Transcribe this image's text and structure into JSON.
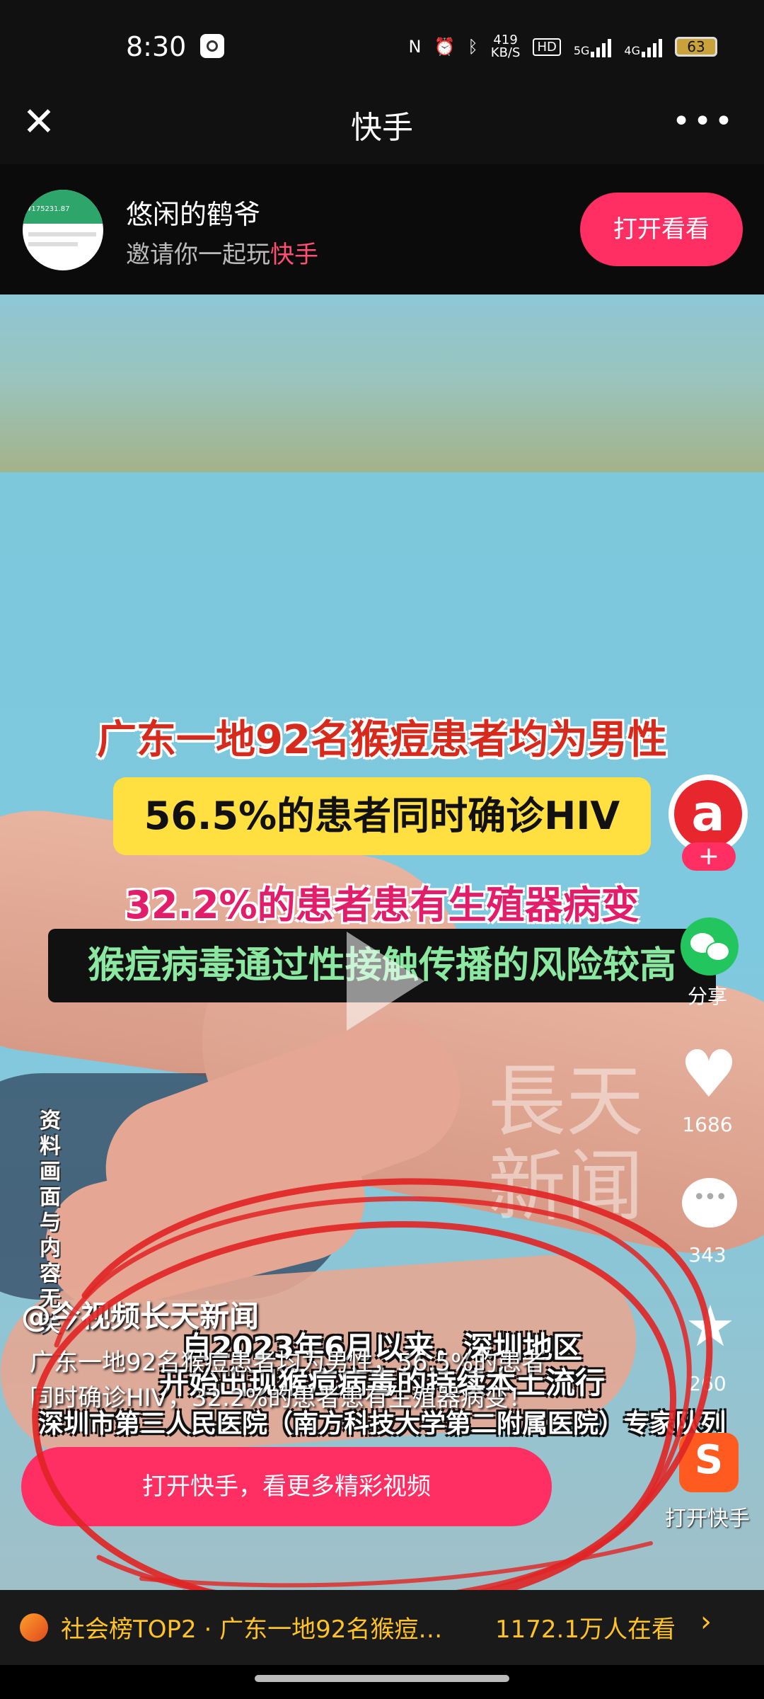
{
  "status_bar": {
    "time": "8:30",
    "net_speed_top": "419",
    "net_speed_unit": "KB/S",
    "hd_badge": "HD",
    "net_5g": "5G",
    "net_4g": "4G",
    "battery": "63",
    "icons": [
      "nfc-icon",
      "alarm-icon",
      "bluetooth-icon",
      "signal-icon",
      "battery-icon"
    ]
  },
  "topbar": {
    "close_glyph": "✕",
    "title": "快手",
    "more_glyph": "•••"
  },
  "invite": {
    "username": "悠闲的鹤爷",
    "text_prefix": "邀请你一起玩",
    "text_highlight": "快手",
    "avatar_amount": "¥175231.87",
    "open_button": "打开看看"
  },
  "video": {
    "headline_1": "广东一地92名猴痘患者均为男性",
    "headline_2": "56.5%的患者同时确诊HIV",
    "headline_3": "32.2%的患者患有生殖器病变",
    "headline_4": "猴痘病毒通过性接触传播的风险较高",
    "watermark_line1": "長天",
    "watermark_line2": "新闻",
    "vertical_note": "资料画面与内容无关",
    "subtitle_1": "自2023年6月以来，深圳地区",
    "subtitle_2": "开始出现猴痘病毒的持续本土流行",
    "subtitle_3": "深圳市第三人民医院（南方科技大学第二附属医院）专家队列"
  },
  "side_actions": {
    "logo_glyph": "a",
    "plus_glyph": "+",
    "share_label": "分享",
    "like_count": "1686",
    "comment_count": "343",
    "favorite_count": "260",
    "open_app_label": "打开快手",
    "heart_glyph": "♥",
    "star_glyph": "★"
  },
  "post": {
    "author": "@今视频长天新闻",
    "description_line1": "广东一地92名猴痘患者均为男性，56.5%的患者",
    "description_line2": "同时确诊HIV，32.2%的患者患有生殖器病变！"
  },
  "cta": {
    "label": "打开快手，看更多精彩视频"
  },
  "bottom_bar": {
    "topic": "社会榜TOP2 · 广东一地92名猴痘…",
    "viewers": "1172.1万人在看",
    "arrow_glyph": "›"
  },
  "colors": {
    "accent": "#ff2e63",
    "highlight_text": "#ff4f73",
    "bottom_text": "#ffc227",
    "annotation_red": "#e02424"
  }
}
